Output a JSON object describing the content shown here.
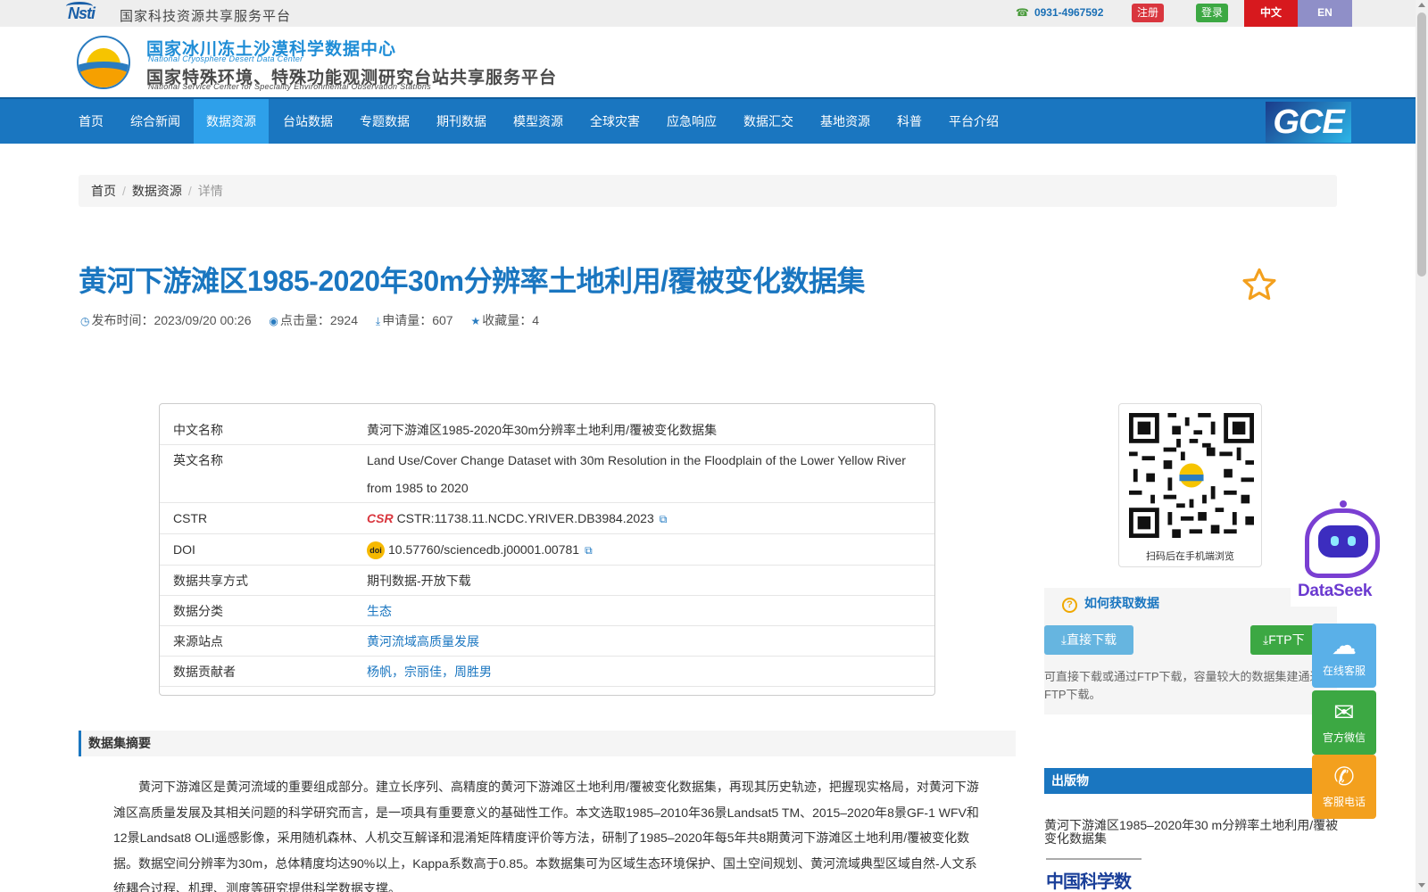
{
  "topbar": {
    "logo_text": "Nsti",
    "platform_title": "国家科技资源共享服务平台",
    "phone": "0931-4967592",
    "register_label": "注册",
    "login_label": "登录",
    "lang_zh": "中文",
    "lang_en": "EN"
  },
  "header": {
    "title_cn": "国家冰川冻土沙漠科学数据中心",
    "title_en": "National Cryosphere Desert Data Center",
    "subtitle_cn": "国家特殊环境、特殊功能观测研究台站共享服务平台",
    "subtitle_en": "National Service Center for Speciality Environmental Observation Stations"
  },
  "nav": {
    "items": [
      {
        "label": "首页"
      },
      {
        "label": "综合新闻"
      },
      {
        "label": "数据资源",
        "active": true
      },
      {
        "label": "台站数据"
      },
      {
        "label": "专题数据"
      },
      {
        "label": "期刊数据"
      },
      {
        "label": "模型资源"
      },
      {
        "label": "全球灾害"
      },
      {
        "label": "应急响应"
      },
      {
        "label": "数据汇交"
      },
      {
        "label": "基地资源"
      },
      {
        "label": "科普"
      },
      {
        "label": "平台介绍"
      }
    ],
    "gce_label": "GCE"
  },
  "breadcrumb": {
    "home": "首页",
    "section": "数据资源",
    "current": "详情"
  },
  "dataset": {
    "title": "黄河下游滩区1985-2020年30m分辨率土地利用/覆被变化数据集",
    "meta": {
      "publish_label": "发布时间：",
      "publish_time": "2023/09/20 00:26",
      "views_label": "点击量：",
      "views": "2924",
      "requests_label": "申请量：",
      "requests": "607",
      "favorites_label": "收藏量：",
      "favorites": "4"
    }
  },
  "info": {
    "rows": [
      {
        "label": "中文名称",
        "value": "黄河下游滩区1985-2020年30m分辨率土地利用/覆被变化数据集"
      },
      {
        "label": "英文名称",
        "value": "Land Use/Cover Change Dataset with 30m Resolution in the Floodplain of the Lower Yellow River from 1985 to 2020"
      },
      {
        "label": "CSTR",
        "value": "CSTR:11738.11.NCDC.YRIVER.DB3984.2023",
        "logo": "CSR"
      },
      {
        "label": "DOI",
        "value": "10.57760/sciencedb.j00001.00781",
        "logo": "doi"
      },
      {
        "label": "数据共享方式",
        "value": "期刊数据-开放下载"
      },
      {
        "label": "数据分类",
        "value": "生态"
      },
      {
        "label": "来源站点",
        "value": "黄河流域高质量发展"
      },
      {
        "label": "数据贡献者",
        "value": "杨帆，宗丽佳，周胜男"
      }
    ]
  },
  "qr": {
    "caption": "扫码后在手机端浏览"
  },
  "getdata": {
    "heading": "如何获取数据",
    "direct_label": "直接下载",
    "ftp_label": "FTP下",
    "description": "可直接下载或通过FTP下载，容量较大的数据集建通过FTP下载。"
  },
  "abstract": {
    "heading": "数据集摘要",
    "text": "黄河下游滩区是黄河流域的重要组成部分。建立长序列、高精度的黄河下游滩区土地利用/覆被变化数据集，再现其历史轨迹，把握现实格局，对黄河下游滩区高质量发展及其相关问题的科学研究而言，是一项具有重要意义的基础性工作。本文选取1985–2010年36景Landsat5 TM、2015–2020年8景GF-1 WFV和12景Landsat8 OLI遥感影像，采用随机森林、人机交互解译和混淆矩阵精度评价等方法，研制了1985–2020年每5年共8期黄河下游滩区土地利用/覆被变化数据。数据空间分辨率为30m，总体精度均达90%以上，Kappa系数高于0.85。本数据集可为区域生态环境保护、国土空间规划、黄河流域典型区域自然-人文系统耦合过程、机理、测度等研究提供科学数据支撑。"
  },
  "publications": {
    "heading": "出版物",
    "title": "黄河下游滩区1985–2020年30 m分辨率土地利用/覆被变化数据集",
    "logo_text": "中国科学数据"
  },
  "widgets": {
    "dataseek_label": "DataSeek",
    "service_label": "在线客服",
    "wechat_label": "官方微信",
    "phone_label": "客服电话"
  }
}
